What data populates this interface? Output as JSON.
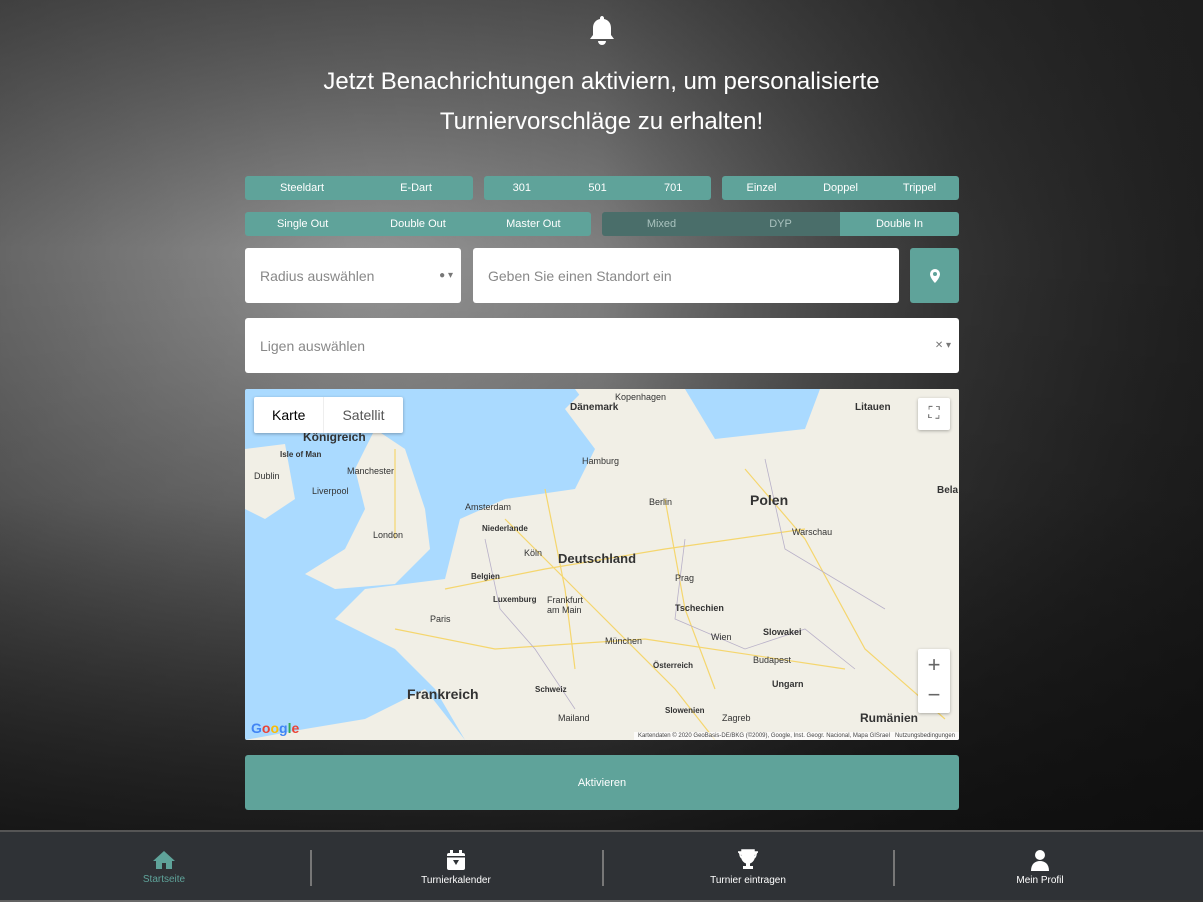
{
  "header": {
    "icon": "bell-icon",
    "line1": "Jetzt Benachrichtungen aktiviern, um personalisierte",
    "line2": "Turniervorschläge zu erhalten!"
  },
  "filters": {
    "dart_type": [
      "Steeldart",
      "E-Dart"
    ],
    "game": [
      "301",
      "501",
      "701"
    ],
    "mode": [
      "Einzel",
      "Doppel",
      "Trippel"
    ],
    "out": [
      "Single Out",
      "Double Out",
      "Master Out"
    ],
    "extra": [
      {
        "label": "Mixed",
        "active": false
      },
      {
        "label": "DYP",
        "active": false
      },
      {
        "label": "Double In",
        "active": true
      }
    ]
  },
  "radius": {
    "placeholder": "Radius auswählen"
  },
  "location": {
    "placeholder": "Geben Sie einen Standort ein",
    "button_icon": "map-marker-icon"
  },
  "leagues": {
    "placeholder": "Ligen auswählen"
  },
  "map": {
    "type_options": [
      "Karte",
      "Satellit"
    ],
    "selected_type": "Karte",
    "labels": [
      "Dänemark",
      "Kopenhagen",
      "Litauen",
      "Königreich",
      "Isle of Man",
      "Manchester",
      "Liverpool",
      "Dublin",
      "Hamburg",
      "Amsterdam",
      "Niederlande",
      "Berlin",
      "Polen",
      "Warschau",
      "London",
      "Köln",
      "Belgien",
      "Deutschland",
      "Luxemburg",
      "Frankfurt am Main",
      "Paris",
      "Prag",
      "Tschechien",
      "Slowakei",
      "München",
      "Wien",
      "Österreich",
      "Budapest",
      "Ungarn",
      "Schweiz",
      "Frankreich",
      "Mailand",
      "Slowenien",
      "Zagreb",
      "Rumänien",
      "Bela"
    ],
    "attribution": "Kartendaten © 2020 GeoBasis-DE/BKG (©2009), Google, Inst. Geogr. Nacional, Mapa GISrael",
    "terms": "Nutzungsbedingungen",
    "logo": "Google"
  },
  "activate_label": "Aktivieren",
  "accent_color": "#5fa39a",
  "nav": [
    {
      "label": "Startseite",
      "icon": "home-icon",
      "active": true
    },
    {
      "label": "Turnierkalender",
      "icon": "calendar-icon",
      "active": false
    },
    {
      "label": "Turnier eintragen",
      "icon": "trophy-icon",
      "active": false
    },
    {
      "label": "Mein Profil",
      "icon": "user-icon",
      "active": false
    }
  ]
}
